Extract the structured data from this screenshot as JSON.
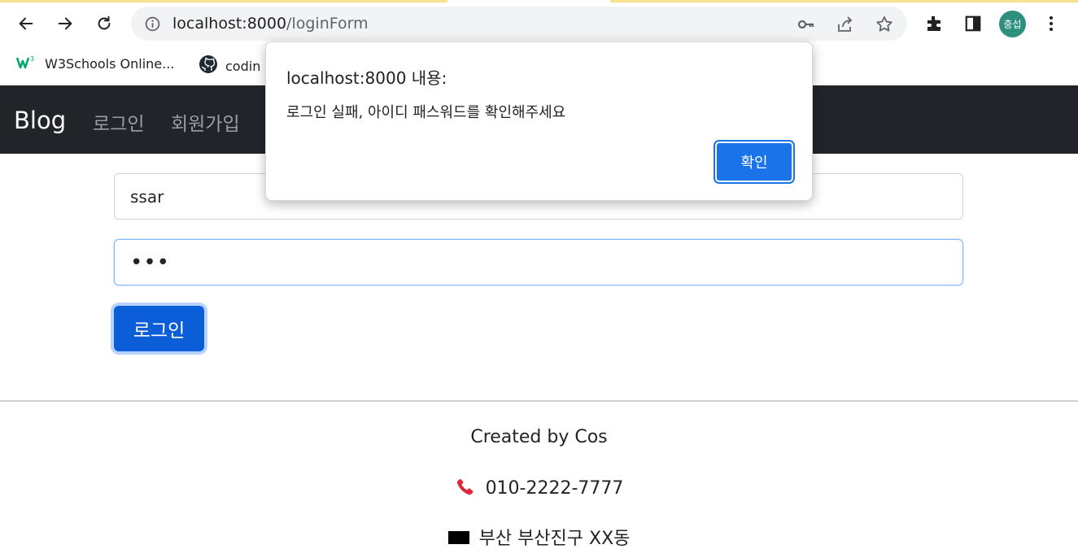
{
  "browser": {
    "url_host": "localhost:8000",
    "url_path": "/loginForm",
    "profile_initials": "충섭",
    "bookmarks": [
      {
        "label": "W3Schools Online...",
        "icon": "w3schools-icon"
      },
      {
        "label": "codin",
        "icon": "github-icon"
      }
    ]
  },
  "navbar": {
    "brand": "Blog",
    "links": [
      "로그인",
      "회원가입"
    ]
  },
  "form": {
    "username_value": "ssar",
    "password_mask": "•••",
    "submit_label": "로그인"
  },
  "footer": {
    "created_by": "Created by Cos",
    "phone": "010-2222-7777",
    "address": "부산 부산진구 XX동"
  },
  "dialog": {
    "title": "localhost:8000 내용:",
    "message": "로그인 실패, 아이디 패스워드를 확인해주세요",
    "ok_label": "확인"
  },
  "colors": {
    "navbar_bg": "#212529",
    "primary": "#0b5ed7",
    "dialog_button": "#1a73e8",
    "profile_bg": "#2d8f7d"
  }
}
